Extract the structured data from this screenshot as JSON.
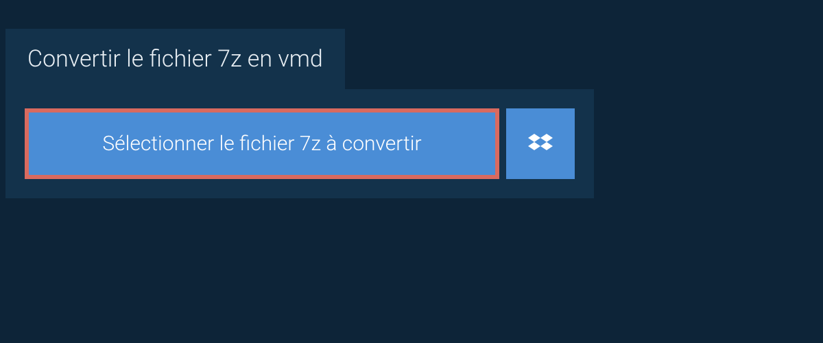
{
  "header": {
    "title": "Convertir le fichier 7z en vmd"
  },
  "upload": {
    "select_button_label": "Sélectionner le fichier 7z à convertir"
  }
}
